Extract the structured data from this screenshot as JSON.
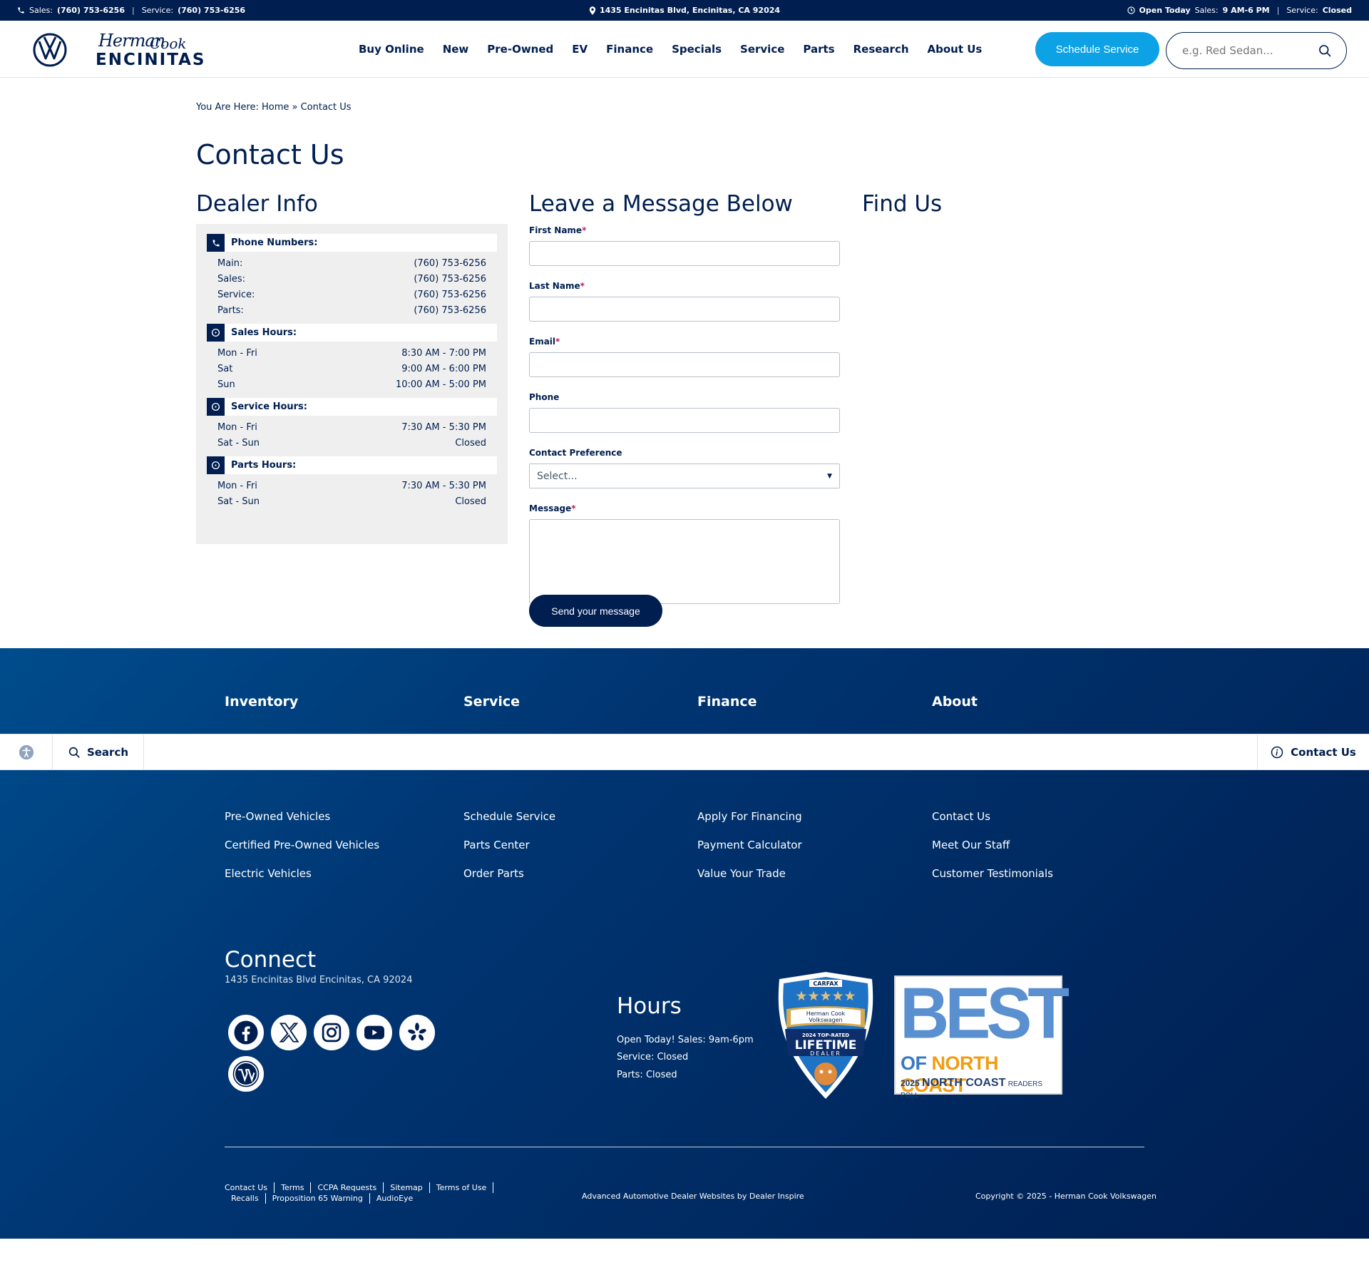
{
  "topbar": {
    "sales_label": "Sales:",
    "sales_phone": "(760) 753-6256",
    "service_label": "Service:",
    "service_phone": "(760) 753-6256",
    "address": "1435 Encinitas Blvd, Encinitas, CA 92024",
    "open_label": "Open Today",
    "sales_hours_label": "Sales:",
    "sales_hours": "9 AM-6 PM",
    "service_hours_label": "Service:",
    "service_hours": "Closed"
  },
  "header": {
    "brand_script_1": "Herman",
    "brand_script_2": "Cook",
    "brand_word": "ENCINITAS",
    "nav": [
      "Buy Online",
      "New",
      "Pre-Owned",
      "EV",
      "Finance",
      "Specials",
      "Service",
      "Parts",
      "Research",
      "About Us"
    ],
    "schedule_label": "Schedule Service",
    "search_placeholder": "e.g. Red Sedan..."
  },
  "main": {
    "breadcrumb": "You Are Here: Home » Contact Us",
    "title": "Contact Us",
    "dealer_title": "Dealer Info",
    "message_title": "Leave a Message Below",
    "find_title": "Find Us",
    "phone_head": "Phone Numbers:",
    "phones": [
      {
        "label": "Main:",
        "value": "(760) 753-6256"
      },
      {
        "label": "Sales:",
        "value": "(760) 753-6256"
      },
      {
        "label": "Service:",
        "value": "(760) 753-6256"
      },
      {
        "label": "Parts:",
        "value": "(760) 753-6256"
      }
    ],
    "sales_head": "Sales Hours:",
    "sales_hours": [
      {
        "day": "Mon - Fri",
        "time": "8:30 AM - 7:00 PM"
      },
      {
        "day": "Sat",
        "time": "9:00 AM - 6:00 PM"
      },
      {
        "day": "Sun",
        "time": "10:00 AM - 5:00 PM"
      }
    ],
    "service_head": "Service Hours:",
    "service_hours": [
      {
        "day": "Mon - Fri",
        "time": "7:30 AM - 5:30 PM"
      },
      {
        "day": "Sat - Sun",
        "time": "Closed"
      }
    ],
    "parts_head": "Parts Hours:",
    "parts_hours": [
      {
        "day": "Mon - Fri",
        "time": "7:30 AM - 5:30 PM"
      },
      {
        "day": "Sat - Sun",
        "time": "Closed"
      }
    ],
    "form": {
      "first_name": "First Name",
      "last_name": "Last Name",
      "email": "Email",
      "phone": "Phone",
      "contact_pref": "Contact Preference",
      "contact_pref_value": "Select...",
      "message": "Message",
      "required_mark": "*",
      "send_label": "Send your message"
    }
  },
  "footer": {
    "inventory_title": "Inventory",
    "inventory_links": [
      "Pre-Owned Vehicles",
      "Certified Pre-Owned Vehicles",
      "Electric Vehicles"
    ],
    "service_title": "Service",
    "service_links": [
      "Schedule Service",
      "Parts Center",
      "Order Parts"
    ],
    "finance_title": "Finance",
    "finance_links": [
      "Apply For Financing",
      "Payment Calculator",
      "Value Your Trade"
    ],
    "about_title": "About",
    "about_links": [
      "Contact Us",
      "Meet Our Staff",
      "Customer Testimonials"
    ],
    "connect_title": "Connect",
    "connect_address": "1435 Encinitas Blvd Encinitas, CA 92024",
    "hours_title": "Hours",
    "hours_lines": [
      "Open Today! Sales: 9am-6pm",
      "Service: Closed",
      "Parts: Closed"
    ],
    "carfax": {
      "brand": "CARFAX",
      "dealer_name_1": "Herman Cook",
      "dealer_name_2": "Volkswagen",
      "year_label": "2024 TOP-RATED",
      "main": "LIFETIME",
      "sub": "DEALER"
    },
    "best": {
      "big": "BEST",
      "of": "OF",
      "region": "NORTH COAST",
      "year": "2025",
      "region2": "NORTH COAST",
      "poll": "READERS POLL"
    },
    "legal_links": [
      "Contact Us",
      "Terms",
      "CCPA Requests",
      "Sitemap",
      "Terms of Use",
      "Recalls",
      "Proposition 65 Warning",
      "AudioEye"
    ],
    "credit": "Advanced Automotive Dealer Websites by Dealer Inspire",
    "copyright": "Copyright © 2025 - Herman Cook Volkswagen"
  },
  "stickybar": {
    "search_label": "Search",
    "contact_label": "Contact Us"
  },
  "colors": {
    "navy": "#001e50",
    "accent_blue": "#0da2e5",
    "panel_gray": "#efefef"
  }
}
